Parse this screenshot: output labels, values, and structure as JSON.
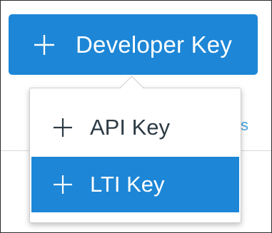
{
  "developer_button": {
    "label": "Developer Key",
    "icon": "plus-icon",
    "background": "#1d86d6"
  },
  "menu": {
    "items": [
      {
        "label": "API Key",
        "icon": "plus-icon",
        "selected": false
      },
      {
        "label": "LTI Key",
        "icon": "plus-icon",
        "selected": true
      }
    ],
    "highlight_color": "#1d86d6"
  }
}
